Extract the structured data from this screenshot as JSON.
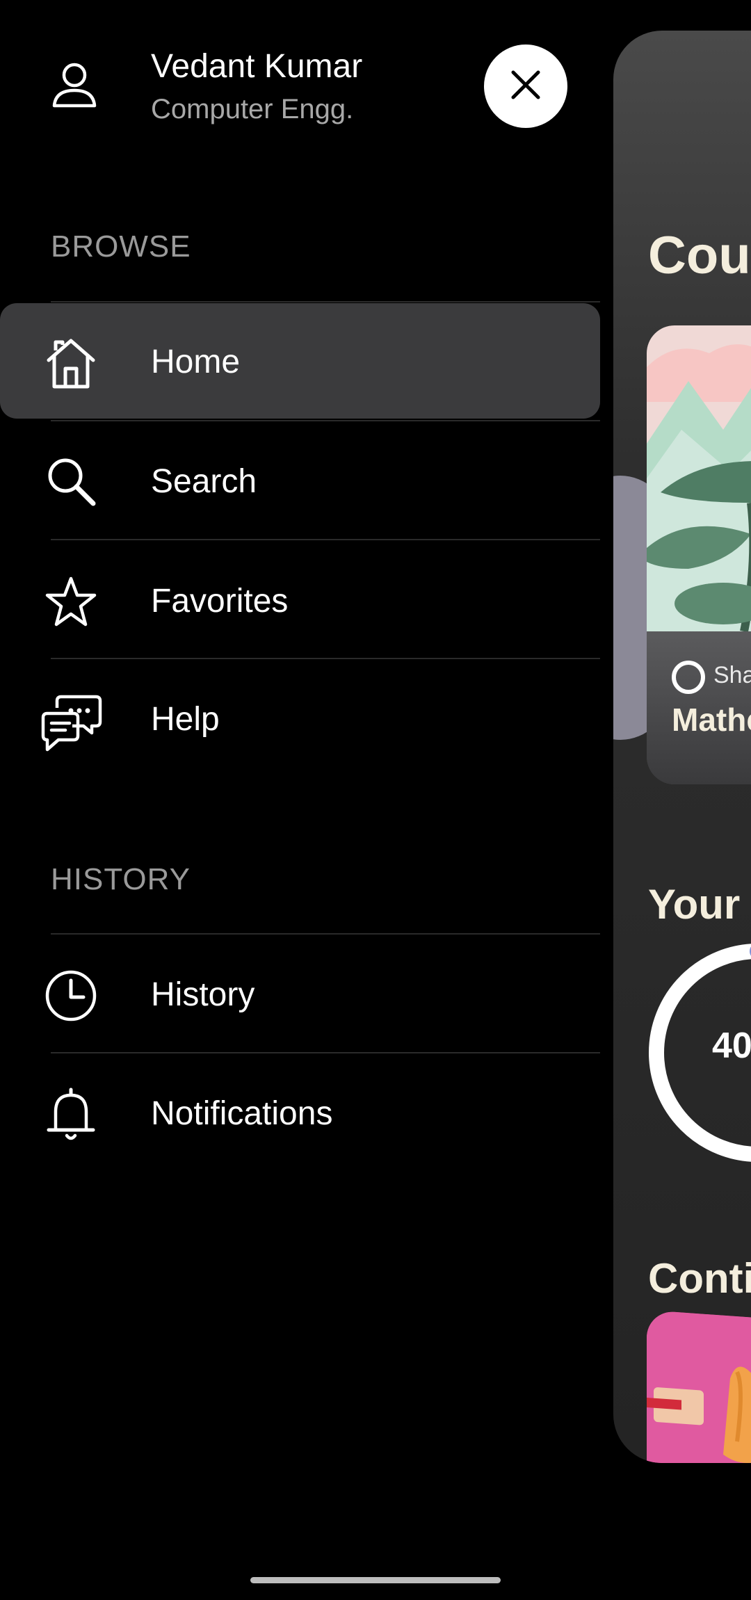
{
  "drawer": {
    "user": {
      "name": "Vedant Kumar",
      "department": "Computer Engg."
    },
    "sections": {
      "browse_label": "BROWSE",
      "history_label": "HISTORY"
    },
    "browse_items": [
      {
        "label": "Home",
        "icon": "home-icon",
        "active": true
      },
      {
        "label": "Search",
        "icon": "search-icon",
        "active": false
      },
      {
        "label": "Favorites",
        "icon": "star-icon",
        "active": false
      },
      {
        "label": "Help",
        "icon": "chat-bubbles-icon",
        "active": false
      }
    ],
    "history_items": [
      {
        "label": "History",
        "icon": "clock-icon"
      },
      {
        "label": "Notifications",
        "icon": "bell-icon"
      }
    ]
  },
  "main_peek": {
    "title": "Cou",
    "course_card": {
      "tag": "Sha",
      "name": "Mathe"
    },
    "progress_heading": "Your",
    "progress_value": "40",
    "continue_heading": "Conti"
  },
  "colors": {
    "background": "#000000",
    "active_item": "#3b3b3d",
    "heading_cream": "#f4eedd",
    "progress_accent": "#7d8fd6"
  }
}
